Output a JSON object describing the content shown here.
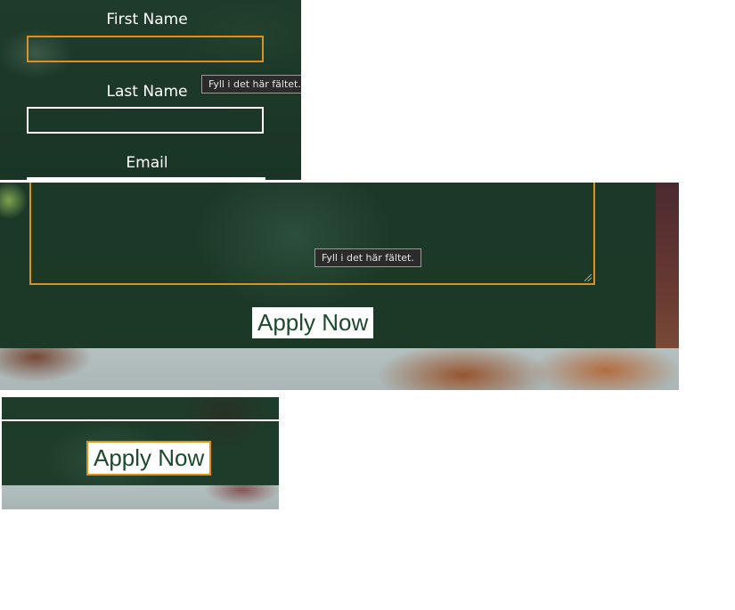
{
  "form": {
    "first_name_label": "First Name",
    "last_name_label": "Last Name",
    "email_label": "Email",
    "first_name_value": "",
    "last_name_value": "",
    "message_value": ""
  },
  "validation": {
    "required_tooltip": "Fyll i det här fältet."
  },
  "actions": {
    "apply_label": "Apply Now"
  },
  "colors": {
    "overlay_green": "#1e3b2b",
    "focus_orange": "#e28e1c",
    "button_text_green": "#1d4a2c"
  }
}
